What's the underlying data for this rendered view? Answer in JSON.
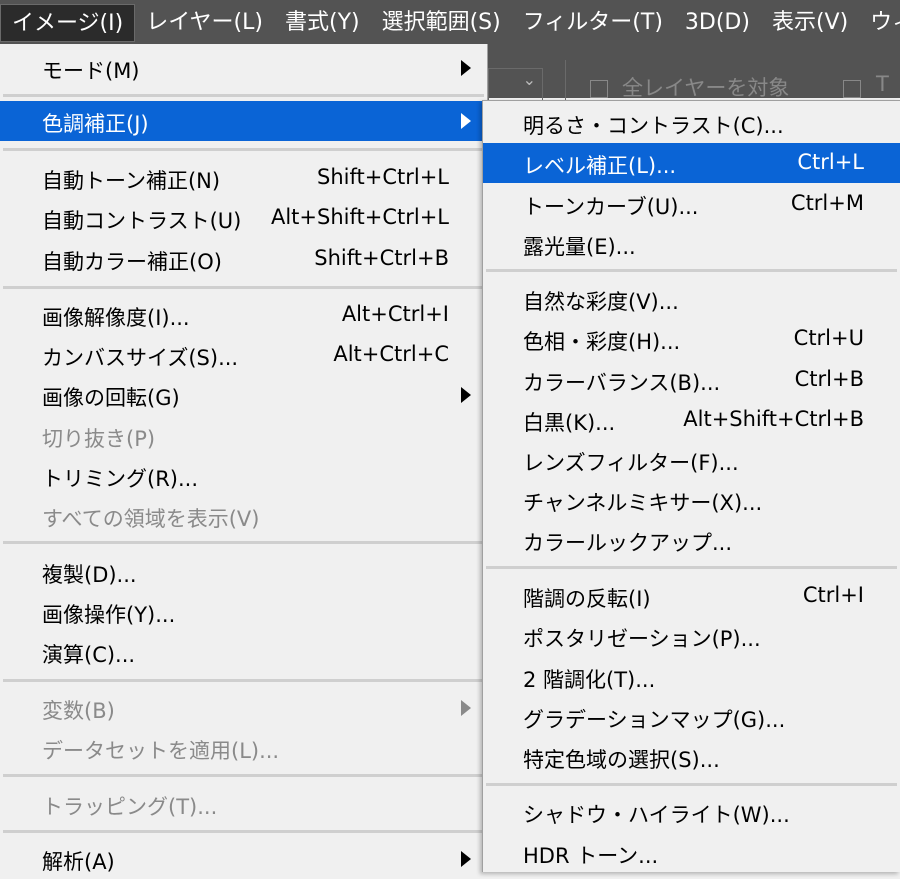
{
  "menubar": {
    "items": [
      "イメージ(I)",
      "レイヤー(L)",
      "書式(Y)",
      "選択範囲(S)",
      "フィルター(T)",
      "3D(D)",
      "表示(V)",
      "ウィ"
    ]
  },
  "options_bar": {
    "checkbox1_label": "全レイヤーを対象",
    "checkbox2_label": "T"
  },
  "main_menu": {
    "mode": "モード(M)",
    "adjustments": "色調補正(J)",
    "auto_tone": "自動トーン補正(N)",
    "auto_tone_sc": "Shift+Ctrl+L",
    "auto_contrast": "自動コントラスト(U)",
    "auto_contrast_sc": "Alt+Shift+Ctrl+L",
    "auto_color": "自動カラー補正(O)",
    "auto_color_sc": "Shift+Ctrl+B",
    "image_size": "画像解像度(I)...",
    "image_size_sc": "Alt+Ctrl+I",
    "canvas_size": "カンバスサイズ(S)...",
    "canvas_size_sc": "Alt+Ctrl+C",
    "rotation": "画像の回転(G)",
    "crop": "切り抜き(P)",
    "trim": "トリミング(R)...",
    "reveal_all": "すべての領域を表示(V)",
    "duplicate": "複製(D)...",
    "apply_image": "画像操作(Y)...",
    "calculations": "演算(C)...",
    "variables": "変数(B)",
    "apply_dataset": "データセットを適用(L)...",
    "trap": "トラッピング(T)...",
    "analysis": "解析(A)"
  },
  "sub_menu": {
    "brightness": "明るさ・コントラスト(C)...",
    "levels": "レベル補正(L)...",
    "levels_sc": "Ctrl+L",
    "curves": "トーンカーブ(U)...",
    "curves_sc": "Ctrl+M",
    "exposure": "露光量(E)...",
    "vibrance": "自然な彩度(V)...",
    "hue_sat": "色相・彩度(H)...",
    "hue_sat_sc": "Ctrl+U",
    "color_balance": "カラーバランス(B)...",
    "color_balance_sc": "Ctrl+B",
    "bw": "白黒(K)...",
    "bw_sc": "Alt+Shift+Ctrl+B",
    "photo_filter": "レンズフィルター(F)...",
    "channel_mixer": "チャンネルミキサー(X)...",
    "color_lookup": "カラールックアップ...",
    "invert": "階調の反転(I)",
    "invert_sc": "Ctrl+I",
    "posterize": "ポスタリゼーション(P)...",
    "threshold": "2 階調化(T)...",
    "gradient_map": "グラデーションマップ(G)...",
    "selective_color": "特定色域の選択(S)...",
    "shadows_highlights": "シャドウ・ハイライト(W)...",
    "hdr_toning": "HDR トーン..."
  },
  "colors": {
    "highlight": "#0a64d6",
    "menubar_bg": "#535353",
    "menu_bg": "#f0f0f0",
    "disabled_text": "#8a8a8a"
  }
}
